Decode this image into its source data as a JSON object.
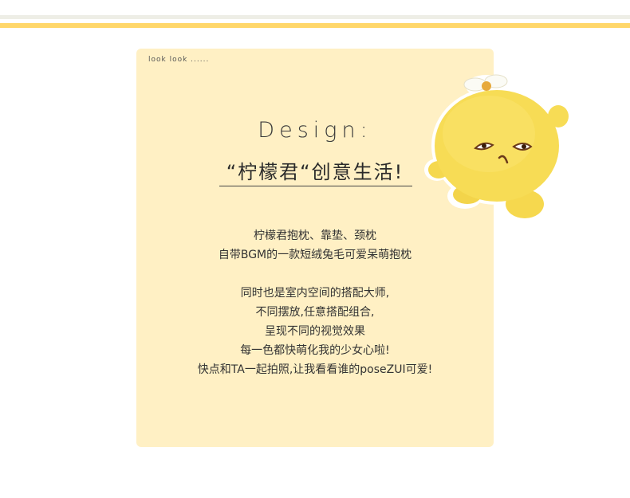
{
  "header": {
    "small_label": "look look ......"
  },
  "title": {
    "design": "Design:",
    "slogan": "“柠檬君“创意生活!"
  },
  "description": {
    "para1": [
      "柠檬君抱枕、靠垫、颈枕",
      "自带BGM的一款短绒兔毛可爱呆萌抱枕"
    ],
    "para2": [
      "同时也是室内空间的搭配大师,",
      "不同摆放,任意搭配组合,",
      "呈现不同的视觉效果",
      "每一色都快萌化我的少女心啦!",
      "快点和TA一起拍照,让我看看谁的poseZUI可爱!"
    ]
  },
  "colors": {
    "card_background": "#fff0c4",
    "accent_stripe": "#ffd76a",
    "mascot_yellow": "#f7dc55"
  },
  "image": {
    "icon": "lemon-plush-icon"
  }
}
